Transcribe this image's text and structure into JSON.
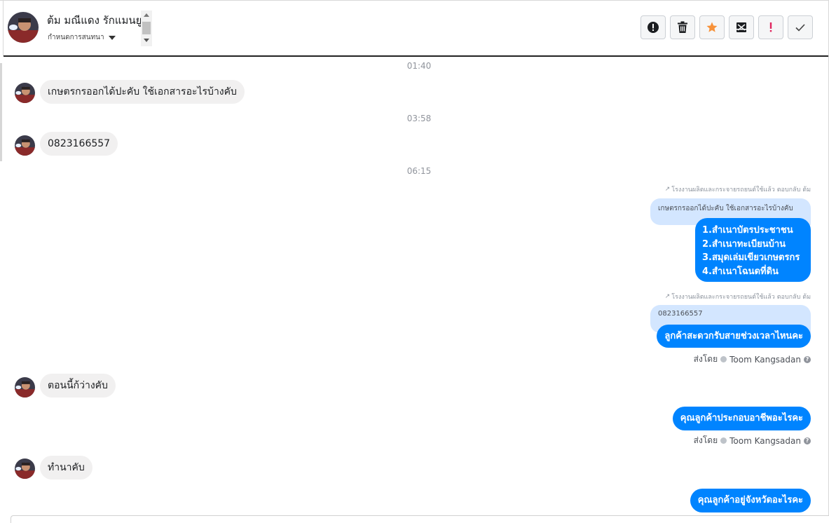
{
  "header": {
    "contact_name": "ต้ม มณีแดง รักแมนยู",
    "assign_label": "กำหนดการสนทนา",
    "toolbar": [
      {
        "name": "spam-button",
        "icon": "alert-circle-icon"
      },
      {
        "name": "delete-button",
        "icon": "trash-icon"
      },
      {
        "name": "star-button",
        "icon": "star-icon"
      },
      {
        "name": "mark-unread-button",
        "icon": "envelope-x-icon"
      },
      {
        "name": "important-button",
        "icon": "exclamation-icon"
      },
      {
        "name": "done-button",
        "icon": "check-icon"
      }
    ]
  },
  "messages": {
    "t1": "01:40",
    "in1": "เกษตรกรออกได้ปะคับ ใช้เอกสารอะไรบ้างคับ",
    "t2": "03:58",
    "in2": "0823166557",
    "t3": "06:15",
    "reply_note_1": "โรงงานผลิตและกระจายรถยนต์ใช้แล้ว ตอบกลับ ต้ม",
    "quote_1": "เกษตรกรออกได้ปะคับ ใช้เอกสารอะไรบ้างคับ",
    "out1_lines": [
      "1.สำเนาบัตรประชาชน",
      "2.สำเนาทะเบียนบ้าน",
      "3.สมุดเล่มเขียวเกษตรกร",
      "4.สำเนาโฉนดที่ดิน"
    ],
    "reply_note_2": "โรงงานผลิตและกระจายรถยนต์ใช้แล้ว ตอบกลับ ต้ม",
    "quote_2": "0823166557",
    "out2": "ลูกค้าสะดวกรับสายช่วงเวลาไหนคะ",
    "sent_by_label": "ส่งโดย",
    "sent_by_name": "Toom Kangsadan",
    "in3": "ตอนนี้ก้ว่างคับ",
    "out3": "คุณลูกค้าประกอบอาชีพอะไรคะ",
    "in4": "ทำนาคับ",
    "out4": "คุณลูกค้าอยู่จังหวัดอะไรคะ"
  },
  "colors": {
    "accent": "#0084ff",
    "incoming_bubble": "#f1f0f0",
    "quote_bubble": "#d3e6ff"
  }
}
